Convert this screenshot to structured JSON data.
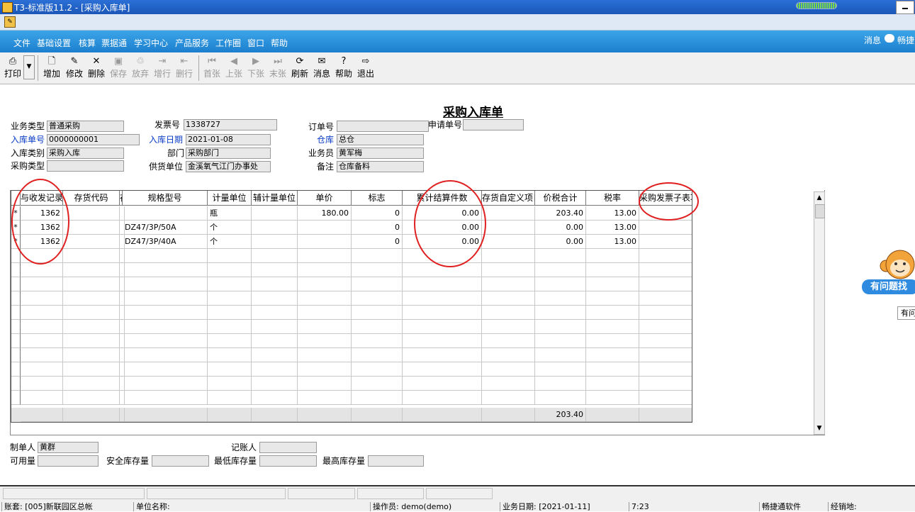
{
  "window": {
    "title": "T3-标准版11.2 - [采购入库单]"
  },
  "menu": {
    "items": [
      "文件",
      "基础设置",
      "核算",
      "票据通",
      "学习中心",
      "产品服务",
      "工作圈",
      "窗口",
      "帮助"
    ],
    "right": {
      "message": "消息",
      "extra": "畅捷"
    }
  },
  "toolbar": {
    "print": "打印",
    "add": "增加",
    "edit": "修改",
    "delete": "删除",
    "save": "保存",
    "discard": "放弃",
    "add_row": "增行",
    "del_row": "删行",
    "first": "首张",
    "prev": "上张",
    "next": "下张",
    "last": "末张",
    "refresh": "刷新",
    "message": "消息",
    "help": "帮助",
    "exit": "退出"
  },
  "doc": {
    "title": "采购入库单",
    "fields": {
      "biz_type_label": "业务类型",
      "biz_type": "普通采购",
      "invoice_no_label": "发票号",
      "invoice_no": "1338727",
      "order_no_label": "订单号",
      "order_no": "",
      "request_no_label": "申请单号",
      "request_no": "",
      "in_no_label": "入库单号",
      "in_no": "0000000001",
      "in_date_label": "入库日期",
      "in_date": "2021-01-08",
      "warehouse_label": "仓库",
      "warehouse": "总仓",
      "in_class_label": "入库类别",
      "in_class": "采购入库",
      "dept_label": "部门",
      "dept": "采购部门",
      "salesman_label": "业务员",
      "salesman": "黄军梅",
      "purchase_type_label": "采购类型",
      "purchase_type": "",
      "supplier_label": "供货单位",
      "supplier": "金溪氧气江门办事处",
      "remark_label": "备注",
      "remark": "仓库备料"
    }
  },
  "grid": {
    "columns": [
      "与收发记录",
      "存货代码",
      "存",
      "规格型号",
      "计量单位",
      "辅计量单位",
      "单价",
      "标志",
      "累计结算件数",
      "存货自定义项目",
      "价税合计",
      "税率",
      "采购发票子表项"
    ],
    "rows": [
      {
        "mark": "*",
        "rec": "1362",
        "code": "",
        "spec": "",
        "unit": "瓶",
        "aux": "",
        "price": "180.00",
        "flag": "0",
        "settled": "0.00",
        "custom": "",
        "total": "203.40",
        "tax": "13.00",
        "sub": ""
      },
      {
        "mark": "*",
        "rec": "1362",
        "code": "",
        "spec": "DZ47/3P/50A",
        "unit": "个",
        "aux": "",
        "price": "",
        "flag": "0",
        "settled": "0.00",
        "custom": "",
        "total": "0.00",
        "tax": "13.00",
        "sub": ""
      },
      {
        "mark": "*",
        "rec": "1362",
        "code": "",
        "spec": "DZ47/3P/40A",
        "unit": "个",
        "aux": "",
        "price": "",
        "flag": "0",
        "settled": "0.00",
        "custom": "",
        "total": "0.00",
        "tax": "13.00",
        "sub": ""
      }
    ],
    "sum_total": "203.40"
  },
  "footer": {
    "maker_label": "制单人",
    "maker": "黄群",
    "bookkeeper_label": "记账人",
    "bookkeeper": "",
    "available_label": "可用量",
    "available": "",
    "safety_label": "安全库存量",
    "safety": "",
    "min_label": "最低库存量",
    "min": "",
    "max_label": "最高库存量",
    "max": ""
  },
  "statusbar": {
    "account": "账套: [005]新联园区总帐",
    "unit": "单位名称:",
    "operator": "操作员: demo(demo)",
    "biz_date": "业务日期: [2021-01-11]",
    "time": "7:23",
    "vendor": "畅捷通软件",
    "dealer": "经销地:"
  },
  "assistant": {
    "button": "有问题找",
    "small": "有问"
  }
}
